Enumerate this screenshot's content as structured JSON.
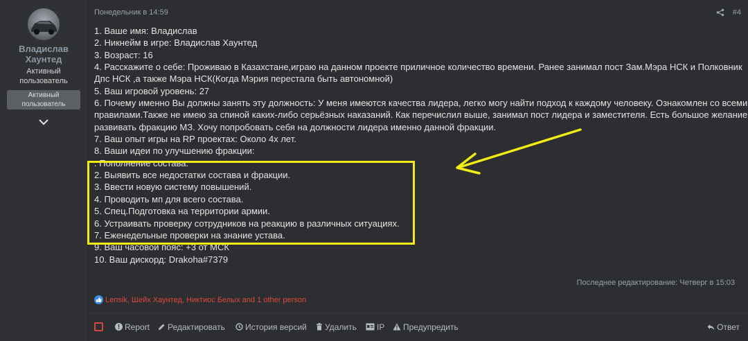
{
  "user": {
    "name_line1": "Владислав",
    "name_line2": "Хаунтед",
    "title_line1": "Активный",
    "title_line2": "пользователь",
    "banner_line1": "Активный",
    "banner_line2": "пользователь"
  },
  "post": {
    "date": "Понедельник в 14:59",
    "number": "#4",
    "lines": [
      "1. Ваше имя: Владислав",
      "2. Никнейм в игре: Владислав Хаунтед",
      "3. Возраст: 16",
      "4. Расскажите о себе: Проживаю в Казахстане,играю на данном проекте приличное количество времени. Ранее занимал пост Зам.Мэра НСК и Полковник",
      "Дпс НСК ,а также Мэра НСК(Когда Мэрия перестала быть автономной)",
      "5. Ваш игровой уровень: 27",
      "6. Почему именно Вы должны занять эту должность: У меня имеются качества лидера, легко могу найти подход к каждому человеку. Ознакомлен со всеми",
      "правилами.Также не имею за спиной каких-либо серьёзных наказаний. Как перечислил выше, занимал пост лидера и заместителя. Есть большое желание",
      "развивать фракцию МЗ. Хочу попробовать себя на должности лидера именно данной фракции.",
      "7. Ваш опыт игры на RP проектах: Около 4х лет.",
      "8. Ваши идеи по улучшению фракции:",
      ". Пополнение состава.",
      "2. Выявить все недостатки состава и фракции.",
      "3. Ввести новую систему повышений.",
      "4. Проводить мп для всего состава.",
      "5. Спец.Подготовка на территории армии.",
      "6. Устраивать проверку сотрудников на реакцию в различных ситуациях.",
      "7. Еженедельные проверки на знание устава.",
      "9. Ваш часовой пояс: +3 от МСК",
      "10. Ваш дискорд: Drakoha#7379"
    ],
    "edited": "Последнее редактирование: Четверг в 15:03",
    "reactions": "Lensik, Шейх Хаунтед, Никтиос Белых and 1 other person"
  },
  "actions": {
    "report": "Report",
    "edit": "Редактировать",
    "history": "История версий",
    "delete": "Удалить",
    "ip": "IP",
    "warn": "Предупредить",
    "reply": "Ответ"
  },
  "colors": {
    "background": "#2c2e31",
    "text": "#e4e4e4",
    "username": "#8c98a4",
    "reactions": "#e0483e",
    "highlight": "#f2ec16"
  }
}
